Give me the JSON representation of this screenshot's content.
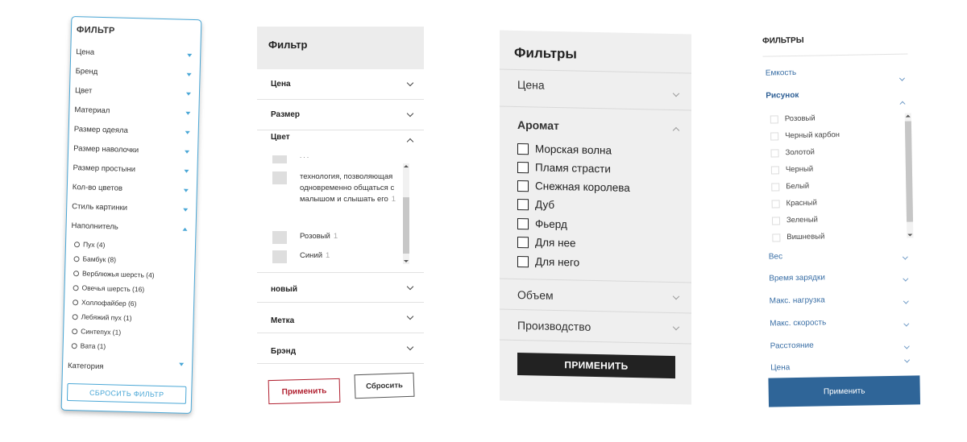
{
  "panel1": {
    "title": "ФИЛЬТР",
    "sections": [
      "Цена",
      "Бренд",
      "Цвет",
      "Материал",
      "Размер одеяла",
      "Размер наволочки",
      "Размер простыни",
      "Кол-во цветов",
      "Стиль картинки",
      "Наполнитель"
    ],
    "options": [
      "Пух (4)",
      "Бамбук (8)",
      "Верблюжья шерсть (4)",
      "Овечья шерсть (16)",
      "Холлофайбер (6)",
      "Лебяжий пух (1)",
      "Синтепух (1)",
      "Вата (1)"
    ],
    "last_section": "Категория",
    "reset_label": "СБРОСИТЬ ФИЛЬТР"
  },
  "panel2": {
    "title": "Фильтр",
    "sections_top": [
      "Цена",
      "Размер",
      "Цвет"
    ],
    "color_items": [
      {
        "label": "технология, позволяющая одновременно общаться с малышом и слышать его",
        "count": "1"
      },
      {
        "label": "Розовый",
        "count": "1"
      },
      {
        "label": "Синий",
        "count": "1"
      }
    ],
    "sections_bottom": [
      "новый",
      "Метка",
      "Брэнд"
    ],
    "apply_label": "Применить",
    "reset_label": "Сбросить"
  },
  "panel3": {
    "title": "Фильтры",
    "section_price": "Цена",
    "section_aroma": "Аромат",
    "options": [
      "Морская волна",
      "Пламя страсти",
      "Снежная королева",
      "Дуб",
      "Фьерд",
      "Для нее",
      "Для него"
    ],
    "section_volume": "Объем",
    "section_maker": "Производство",
    "apply_label": "ПРИМЕНИТЬ"
  },
  "panel4": {
    "title": "ФИЛЬТРЫ",
    "section_capacity": "Емкость",
    "section_pattern": "Рисунок",
    "options": [
      "Розовый",
      "Черный карбон",
      "Золотой",
      "Черный",
      "Белый",
      "Красный",
      "Зеленый",
      "Вишневый"
    ],
    "sections_bottom": [
      "Вес",
      "Время зарядки",
      "Макс. нагрузка",
      "Макс. скорость",
      "Расстояние",
      "Цена"
    ],
    "apply_label": "Применить"
  },
  "colors": {
    "panel1_accent": "#4aa7d6",
    "panel2_apply": "#b01e2e",
    "panel3_bg": "#efefef",
    "panel3_button": "#222222",
    "panel4_link": "#3a6fa6",
    "panel4_button": "#2f6598"
  }
}
